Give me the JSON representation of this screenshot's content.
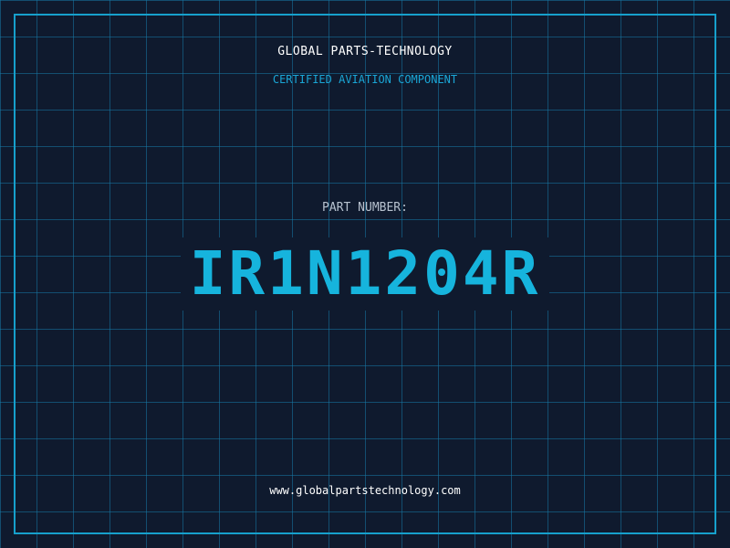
{
  "header": {
    "company_name": "GLOBAL PARTS-TECHNOLOGY",
    "certification": "CERTIFIED AVIATION COMPONENT"
  },
  "part": {
    "label": "PART NUMBER:",
    "number": "IR1N1204R"
  },
  "footer": {
    "website": "www.globalpartstechnology.com"
  },
  "colors": {
    "background": "#0f1a2e",
    "grid": "#1678a5",
    "accent": "#16b4dd",
    "text": "#ffffff"
  }
}
